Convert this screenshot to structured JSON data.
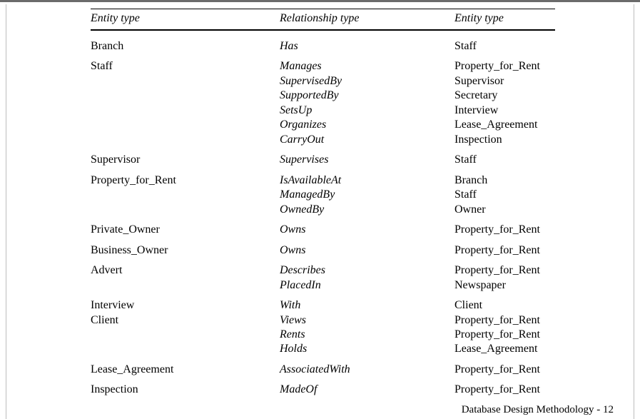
{
  "headers": {
    "col1": "Entity type",
    "col2": "Relationship type",
    "col3": "Entity type"
  },
  "rows": [
    {
      "left": [
        "Branch"
      ],
      "rel": [
        "Has"
      ],
      "right": [
        "Staff"
      ]
    },
    {
      "left": [
        "Staff"
      ],
      "rel": [
        "Manages",
        "SupervisedBy",
        "SupportedBy",
        "SetsUp",
        "Organizes",
        "CarryOut"
      ],
      "right": [
        "Property_for_Rent",
        "Supervisor",
        "Secretary",
        "Interview",
        "Lease_Agreement",
        "Inspection"
      ]
    },
    {
      "left": [
        "Supervisor"
      ],
      "rel": [
        "Supervises"
      ],
      "right": [
        "Staff"
      ]
    },
    {
      "left": [
        "Property_for_Rent"
      ],
      "rel": [
        "IsAvailableAt",
        "ManagedBy",
        "OwnedBy"
      ],
      "right": [
        "Branch",
        "Staff",
        "Owner"
      ]
    },
    {
      "left": [
        "Private_Owner"
      ],
      "rel": [
        "Owns"
      ],
      "right": [
        "Property_for_Rent"
      ]
    },
    {
      "left": [
        "Business_Owner"
      ],
      "rel": [
        "Owns"
      ],
      "right": [
        "Property_for_Rent"
      ]
    },
    {
      "left": [
        "Advert"
      ],
      "rel": [
        "Describes",
        "PlacedIn"
      ],
      "right": [
        "Property_for_Rent",
        "Newspaper"
      ]
    },
    {
      "left": [
        "Interview",
        "Client"
      ],
      "rel": [
        "With",
        "Views",
        "Rents",
        "Holds"
      ],
      "right": [
        "Client",
        "Property_for_Rent",
        "Property_for_Rent",
        "Lease_Agreement"
      ]
    },
    {
      "left": [
        "Lease_Agreement"
      ],
      "rel": [
        "AssociatedWith"
      ],
      "right": [
        "Property_for_Rent"
      ]
    },
    {
      "left": [
        "Inspection"
      ],
      "rel": [
        "MadeOf"
      ],
      "right": [
        "Property_for_Rent"
      ]
    }
  ],
  "footer": "Database Design Methodology - 12"
}
